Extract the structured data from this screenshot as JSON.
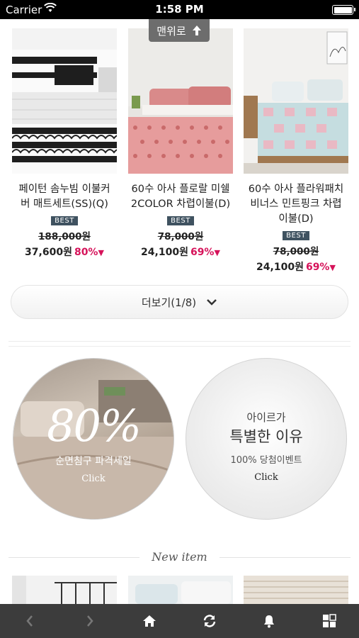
{
  "status_bar": {
    "carrier": "Carrier",
    "time": "1:58 PM"
  },
  "top_button": {
    "label": "맨위로"
  },
  "products": [
    {
      "name_line1": "페이턴 솜누빔 이불커",
      "name_line2": "버 매트세트(SS)(Q)",
      "name_line3": "",
      "badge": "BEST",
      "original_price": "188,000원",
      "sale_price": "37,600원",
      "discount": "80%"
    },
    {
      "name_line1": "60수 아사 플로랄 미쉘",
      "name_line2": "2COLOR 차렵이불(D)",
      "name_line3": "",
      "badge": "BEST",
      "original_price": "78,000원",
      "sale_price": "24,100원",
      "discount": "69%"
    },
    {
      "name_line1": "60수 아사 플라워패치",
      "name_line2": "비너스 민트핑크 차렵",
      "name_line3": "이불(D)",
      "badge": "BEST",
      "original_price": "78,000원",
      "sale_price": "24,100원",
      "discount": "69%"
    }
  ],
  "more_button": {
    "label": "더보기(1/8)"
  },
  "promo_sale": {
    "headline": "80%",
    "subtitle": "순면침구 파격세일",
    "cta": "Click"
  },
  "promo_event": {
    "line1": "아이르가",
    "line2": "특별한 이유",
    "line3": "100% 당첨이벤트",
    "cta": "Click"
  },
  "section_title": "New item",
  "tab_bar": [
    "back-icon",
    "forward-icon",
    "home-icon",
    "refresh-icon",
    "bell-icon",
    "grid-icon"
  ],
  "colors": {
    "accent": "#d6135a",
    "badge": "#3f5260",
    "tab_bar": "#3c3c3c"
  }
}
